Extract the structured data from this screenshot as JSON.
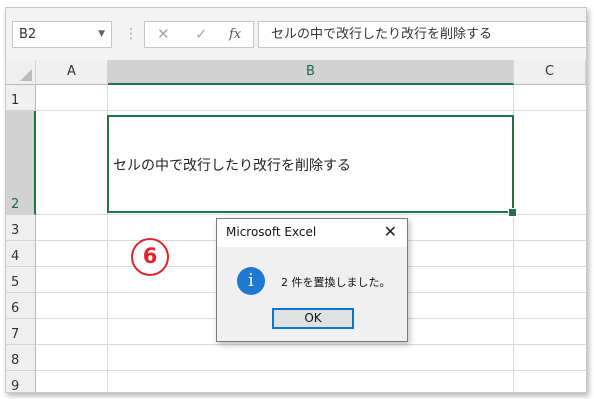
{
  "name_box": {
    "value": "B2"
  },
  "formula_bar": {
    "cancel_icon": "✕",
    "enter_icon": "✓",
    "fx_label": "fx",
    "content": "セルの中で改行したり改行を削除する"
  },
  "columns": [
    "A",
    "B",
    "C"
  ],
  "rows": [
    "1",
    "2",
    "3",
    "4",
    "5",
    "6",
    "7",
    "8",
    "9"
  ],
  "selected_column": "B",
  "selected_row": "2",
  "active_cell": {
    "ref": "B2",
    "text": "セルの中で改行したり改行を削除する"
  },
  "step_badge": "6",
  "dialog": {
    "title": "Microsoft Excel",
    "close_symbol": "✕",
    "icon": "info-icon",
    "message": "2 件を置換しました。",
    "ok_label": "OK"
  },
  "colors": {
    "accent": "#217346",
    "badge": "#e0242b",
    "info": "#1f78d1",
    "focus": "#0078d7"
  }
}
